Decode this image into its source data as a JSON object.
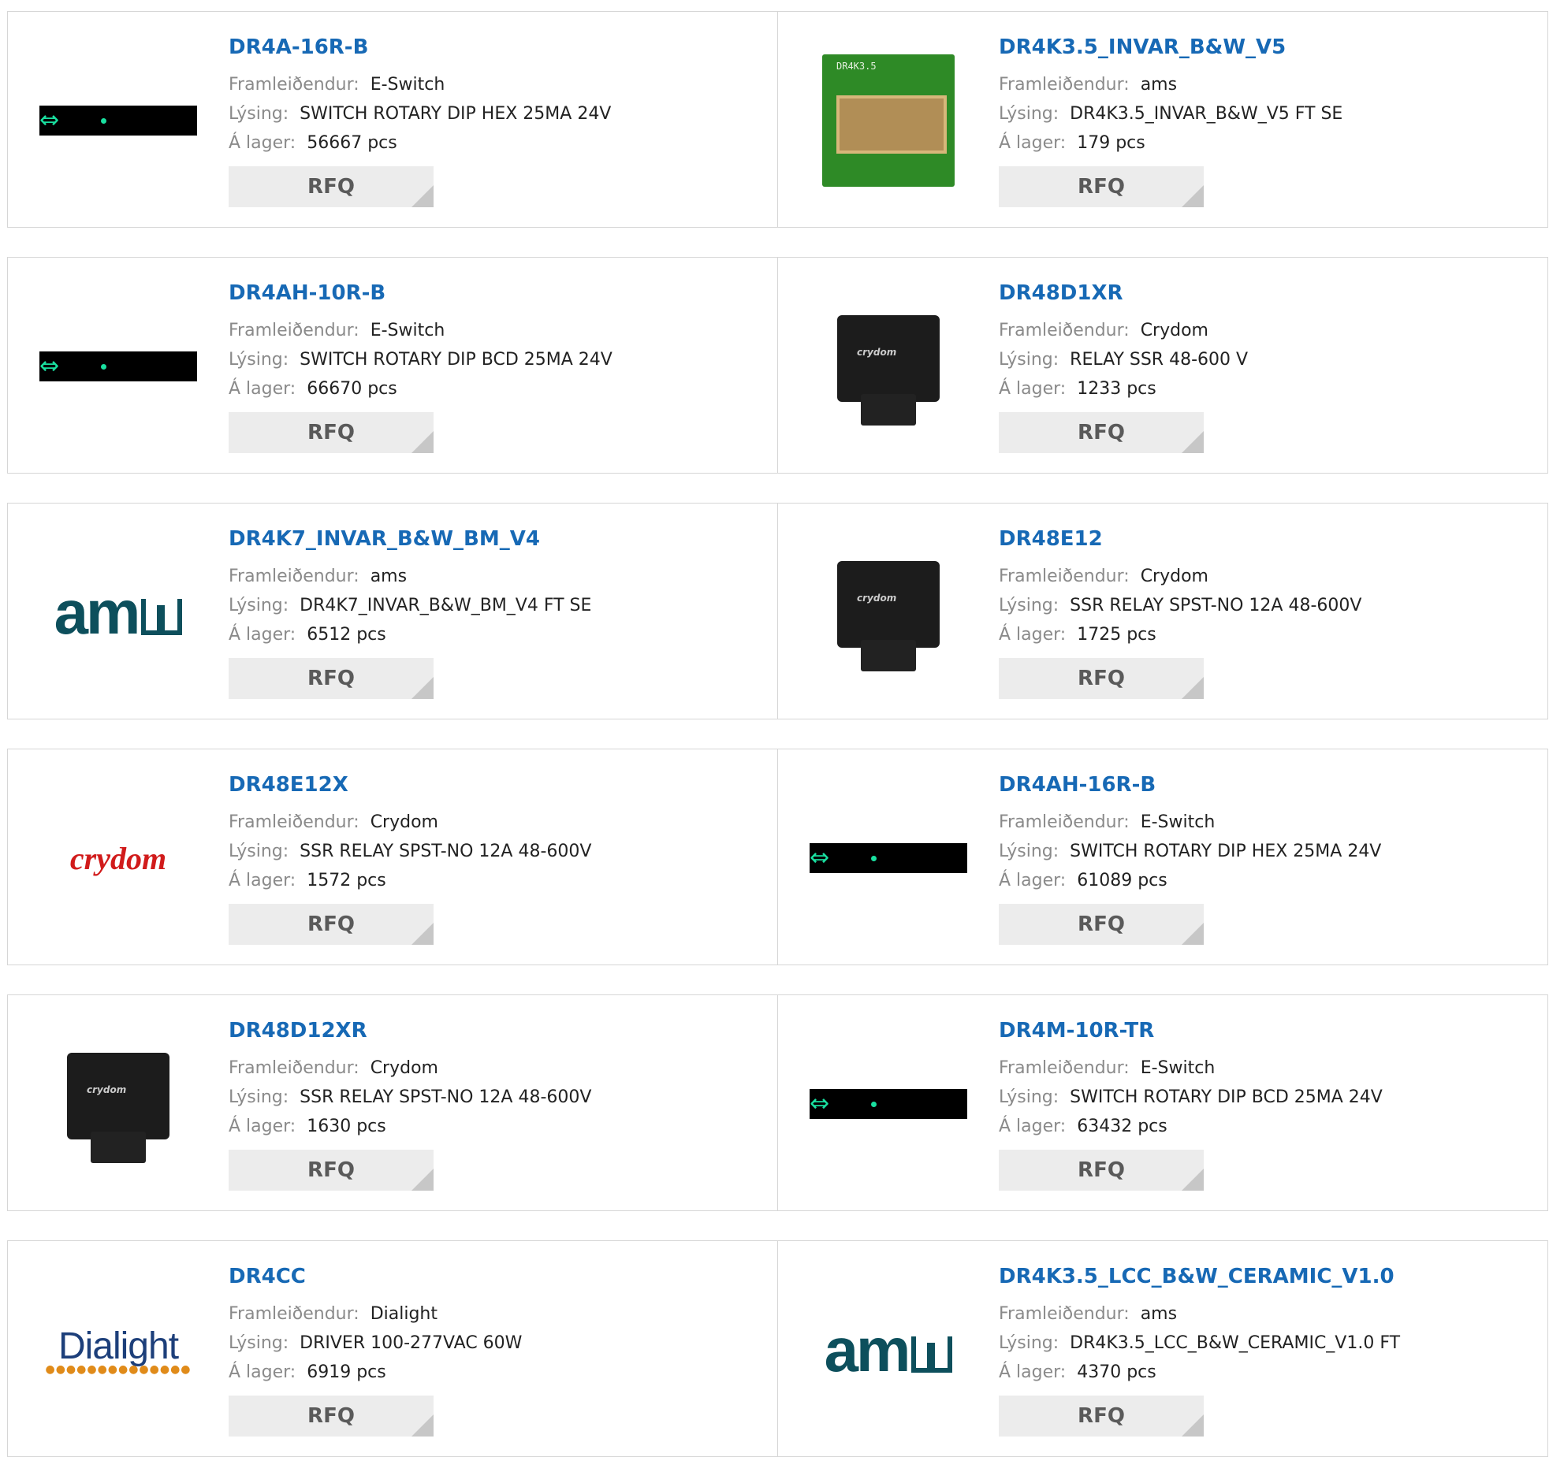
{
  "labels": {
    "manufacturer": "Framleiðendur:",
    "description": "Lýsing:",
    "stock": "Á lager:",
    "rfq": "RFQ"
  },
  "products": [
    {
      "name": "DR4A-16R-B",
      "manufacturer": "E-Switch",
      "description": "SWITCH ROTARY DIP HEX 25MA 24V",
      "stock": "56667 pcs",
      "image": "switch-image"
    },
    {
      "name": "DR4K3.5_INVAR_B&W_V5",
      "manufacturer": "ams",
      "description": "DR4K3.5_INVAR_B&W_V5 FT SE",
      "stock": "179 pcs",
      "image": "pcb-image"
    },
    {
      "name": "DR4AH-10R-B",
      "manufacturer": "E-Switch",
      "description": "SWITCH ROTARY DIP BCD 25MA 24V",
      "stock": "66670 pcs",
      "image": "switch-image"
    },
    {
      "name": "DR48D1XR",
      "manufacturer": "Crydom",
      "description": "RELAY SSR 48-600 V",
      "stock": "1233 pcs",
      "image": "relay-image"
    },
    {
      "name": "DR4K7_INVAR_B&W_BM_V4",
      "manufacturer": "ams",
      "description": "DR4K7_INVAR_B&W_BM_V4 FT SE",
      "stock": "6512 pcs",
      "image": "ams-logo"
    },
    {
      "name": "DR48E12",
      "manufacturer": "Crydom",
      "description": "SSR RELAY SPST-NO 12A 48-600V",
      "stock": "1725 pcs",
      "image": "relay-image"
    },
    {
      "name": "DR48E12X",
      "manufacturer": "Crydom",
      "description": "SSR RELAY SPST-NO 12A 48-600V",
      "stock": "1572 pcs",
      "image": "crydom-logo"
    },
    {
      "name": "DR4AH-16R-B",
      "manufacturer": "E-Switch",
      "description": "SWITCH ROTARY DIP HEX 25MA 24V",
      "stock": "61089 pcs",
      "image": "switch-image"
    },
    {
      "name": "DR48D12XR",
      "manufacturer": "Crydom",
      "description": "SSR RELAY SPST-NO 12A 48-600V",
      "stock": "1630 pcs",
      "image": "relay-image"
    },
    {
      "name": "DR4M-10R-TR",
      "manufacturer": "E-Switch",
      "description": "SWITCH ROTARY DIP BCD 25MA 24V",
      "stock": "63432 pcs",
      "image": "switch-image"
    },
    {
      "name": "DR4CC",
      "manufacturer": "Dialight",
      "description": "DRIVER 100-277VAC 60W",
      "stock": "6919 pcs",
      "image": "dialight-logo"
    },
    {
      "name": "DR4K3.5_LCC_B&W_CERAMIC_V1.0",
      "manufacturer": "ams",
      "description": "DR4K3.5_LCC_B&W_CERAMIC_V1.0 FT",
      "stock": "4370 pcs",
      "image": "ams-logo"
    }
  ],
  "logos": {
    "ams": "am",
    "crydom": "crydom",
    "dialight": "Dialight",
    "pcb_text": "DR4K3.5",
    "relay_brand": "crydom"
  },
  "colors": {
    "link": "#1769b5",
    "label": "#8a8a8a",
    "rfq_bg": "#ececec",
    "border": "#d6d6d6"
  }
}
